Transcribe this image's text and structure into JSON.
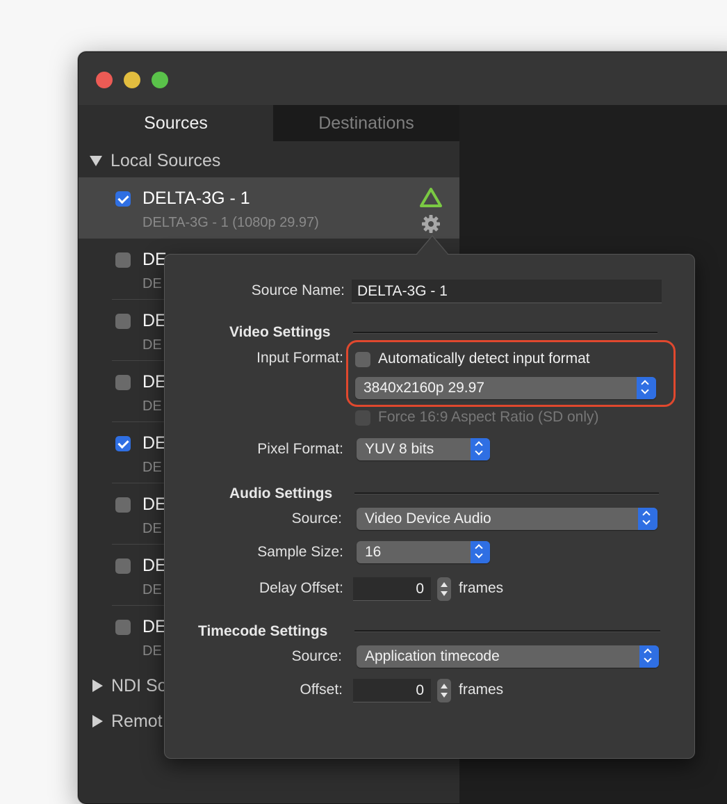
{
  "window": {
    "tabs": {
      "sources": "Sources",
      "destinations": "Destinations"
    }
  },
  "sidebar": {
    "local_sources_label": "Local Sources",
    "ndi_sources_label": "NDI So",
    "remote_label": "Remot",
    "items": [
      {
        "name": "DELTA-3G - 1",
        "subtitle": "DELTA-3G - 1 (1080p 29.97)",
        "checked": true,
        "selected": true
      },
      {
        "name": "DE",
        "subtitle": "DE",
        "checked": false
      },
      {
        "name": "DE",
        "subtitle": "DE",
        "checked": false
      },
      {
        "name": "DE",
        "subtitle": "DE",
        "checked": false
      },
      {
        "name": "DE",
        "subtitle": "DE",
        "checked": true
      },
      {
        "name": "DE",
        "subtitle": "DE",
        "checked": false
      },
      {
        "name": "DE",
        "subtitle": "DE",
        "checked": false
      },
      {
        "name": "DE",
        "subtitle": "DE",
        "checked": false
      }
    ]
  },
  "popover": {
    "source_name_label": "Source Name:",
    "source_name_value": "DELTA-3G - 1",
    "video_settings_header": "Video Settings",
    "input_format_label": "Input Format:",
    "auto_detect_label": "Automatically detect input format",
    "auto_detect_checked": false,
    "input_format_value": "3840x2160p 29.97",
    "force_aspect_label": "Force 16:9 Aspect Ratio (SD only)",
    "pixel_format_label": "Pixel Format:",
    "pixel_format_value": "YUV 8 bits",
    "audio_settings_header": "Audio Settings",
    "audio_source_label": "Source:",
    "audio_source_value": "Video Device Audio",
    "sample_size_label": "Sample Size:",
    "sample_size_value": "16",
    "delay_offset_label": "Delay Offset:",
    "delay_offset_value": "0",
    "delay_unit": "frames",
    "timecode_settings_header": "Timecode Settings",
    "timecode_source_label": "Source:",
    "timecode_source_value": "Application timecode",
    "offset_label": "Offset:",
    "offset_value": "0",
    "offset_unit": "frames"
  },
  "colors": {
    "accent": "#2f6fe3",
    "highlight": "#e0482e",
    "delta_green": "#7ac943"
  }
}
